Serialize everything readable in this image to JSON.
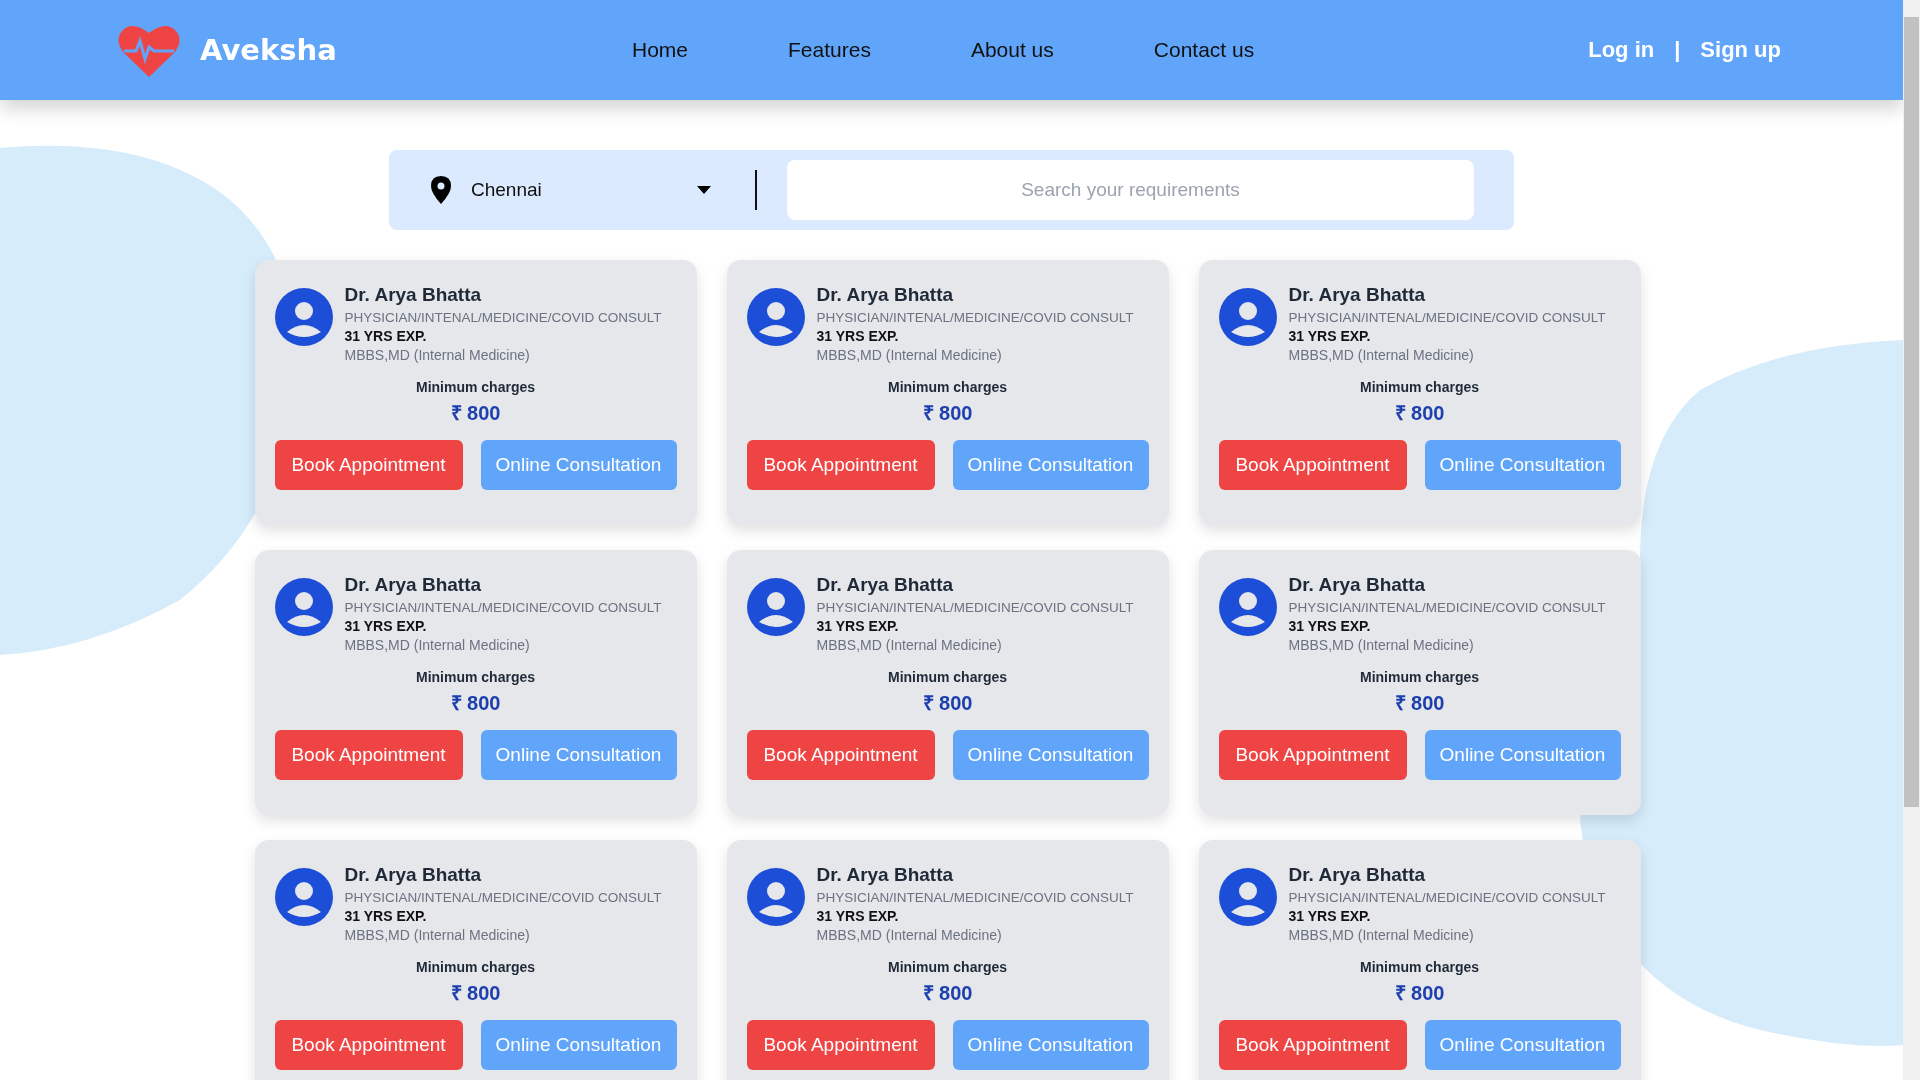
{
  "header": {
    "brand": "Aveksha",
    "nav": [
      {
        "label": "Home"
      },
      {
        "label": "Features"
      },
      {
        "label": "About us"
      },
      {
        "label": "Contact us"
      }
    ],
    "auth": {
      "login": "Log in",
      "separator": "|",
      "signup": "Sign up"
    }
  },
  "search": {
    "location": "Chennai",
    "placeholder": "Search your requirements"
  },
  "doctors": [
    {
      "name": "Dr. Arya Bhatta",
      "specialty": "PHYSICIAN/INTENAL/MEDICINE/COVID CONSULT",
      "experience": "31 YRS EXP.",
      "degree": "MBBS,MD (Internal Medicine)",
      "charges_label": "Minimum charges",
      "charge": "₹ 800",
      "buttons": [
        "Book Appointment",
        "Online Consultation"
      ]
    },
    {
      "name": "Dr. Arya Bhatta",
      "specialty": "PHYSICIAN/INTENAL/MEDICINE/COVID CONSULT",
      "experience": "31 YRS EXP.",
      "degree": "MBBS,MD (Internal Medicine)",
      "charges_label": "Minimum charges",
      "charge": "₹ 800",
      "buttons": [
        "Book Appointment",
        "Online Consultation"
      ]
    },
    {
      "name": "Dr. Arya Bhatta",
      "specialty": "PHYSICIAN/INTENAL/MEDICINE/COVID CONSULT",
      "experience": "31 YRS EXP.",
      "degree": "MBBS,MD (Internal Medicine)",
      "charges_label": "Minimum charges",
      "charge": "₹ 800",
      "buttons": [
        "Book Appointment",
        "Online Consultation"
      ]
    },
    {
      "name": "Dr. Arya Bhatta",
      "specialty": "PHYSICIAN/INTENAL/MEDICINE/COVID CONSULT",
      "experience": "31 YRS EXP.",
      "degree": "MBBS,MD (Internal Medicine)",
      "charges_label": "Minimum charges",
      "charge": "₹ 800",
      "buttons": [
        "Book Appointment",
        "Online Consultation"
      ]
    },
    {
      "name": "Dr. Arya Bhatta",
      "specialty": "PHYSICIAN/INTENAL/MEDICINE/COVID CONSULT",
      "experience": "31 YRS EXP.",
      "degree": "MBBS,MD (Internal Medicine)",
      "charges_label": "Minimum charges",
      "charge": "₹ 800",
      "buttons": [
        "Book Appointment",
        "Online Consultation"
      ]
    },
    {
      "name": "Dr. Arya Bhatta",
      "specialty": "PHYSICIAN/INTENAL/MEDICINE/COVID CONSULT",
      "experience": "31 YRS EXP.",
      "degree": "MBBS,MD (Internal Medicine)",
      "charges_label": "Minimum charges",
      "charge": "₹ 800",
      "buttons": [
        "Book Appointment",
        "Online Consultation"
      ]
    },
    {
      "name": "Dr. Arya Bhatta",
      "specialty": "PHYSICIAN/INTENAL/MEDICINE/COVID CONSULT",
      "experience": "31 YRS EXP.",
      "degree": "MBBS,MD (Internal Medicine)",
      "charges_label": "Minimum charges",
      "charge": "₹ 800",
      "buttons": [
        "Book Appointment",
        "Online Consultation"
      ]
    },
    {
      "name": "Dr. Arya Bhatta",
      "specialty": "PHYSICIAN/INTENAL/MEDICINE/COVID CONSULT",
      "experience": "31 YRS EXP.",
      "degree": "MBBS,MD (Internal Medicine)",
      "charges_label": "Minimum charges",
      "charge": "₹ 800",
      "buttons": [
        "Book Appointment",
        "Online Consultation"
      ]
    },
    {
      "name": "Dr. Arya Bhatta",
      "specialty": "PHYSICIAN/INTENAL/MEDICINE/COVID CONSULT",
      "experience": "31 YRS EXP.",
      "degree": "MBBS,MD (Internal Medicine)",
      "charges_label": "Minimum charges",
      "charge": "₹ 800",
      "buttons": [
        "Book Appointment",
        "Online Consultation"
      ]
    }
  ]
}
